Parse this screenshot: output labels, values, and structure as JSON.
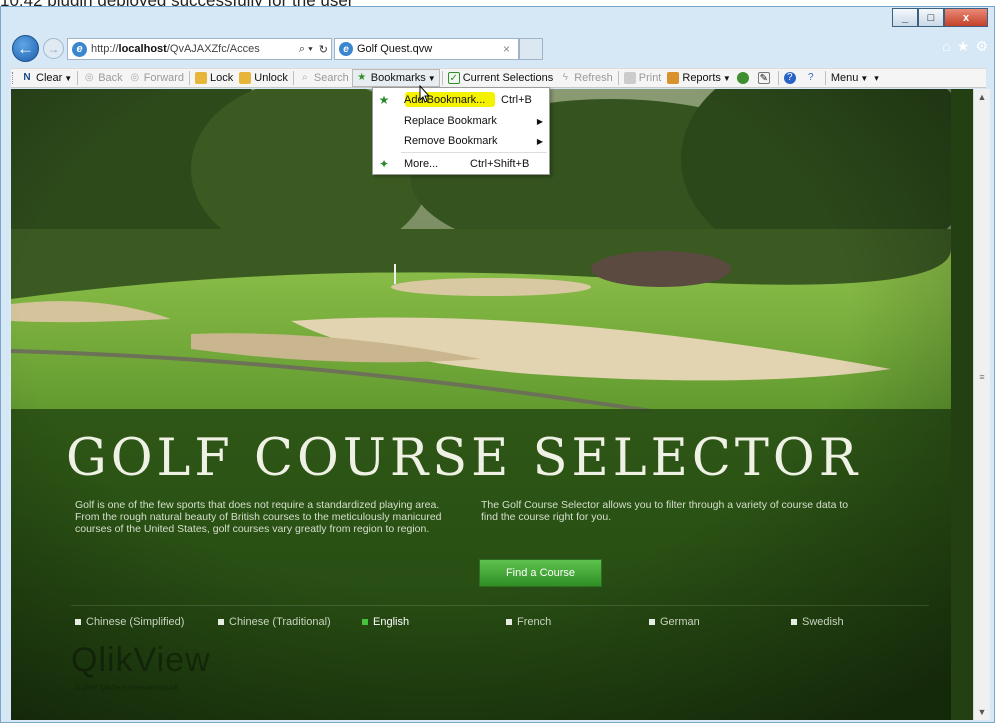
{
  "caption": "10.42 plugin deployed successfully for the user",
  "window": {
    "controls": [
      "_",
      "□",
      "x"
    ],
    "right_icons": [
      "⌂",
      "★",
      "⚙"
    ]
  },
  "browser": {
    "back_icon": "back-arrow-icon",
    "forward_icon": "forward-arrow-icon",
    "url_prefix": "http://",
    "url_host": "localhost",
    "url_path": "/QvAJAXZfc/Acces",
    "search_icon": "⌕",
    "refresh_icon": "↻",
    "tab_title": "Golf Quest.qvw",
    "tab_close": "×"
  },
  "toolbar": {
    "clear": "Clear",
    "back": "Back",
    "forward": "Forward",
    "lock": "Lock",
    "unlock": "Unlock",
    "search": "Search",
    "bookmarks": "Bookmarks",
    "current_selections": "Current Selections",
    "refresh": "Refresh",
    "print": "Print",
    "reports": "Reports",
    "menu": "Menu"
  },
  "bookmarks_menu": {
    "items": [
      {
        "label": "Add Bookmark...",
        "shortcut": "Ctrl+B",
        "icon": "star-icon"
      },
      {
        "label": "Replace Bookmark",
        "shortcut": "",
        "submenu": true
      },
      {
        "label": "Remove Bookmark",
        "shortcut": "",
        "submenu": true
      },
      {
        "label": "More...",
        "shortcut": "Ctrl+Shift+B",
        "icon": "stars-icon"
      }
    ]
  },
  "page": {
    "title": "GOLF COURSE SELECTOR",
    "intro_left": "Golf is one of the few sports that does not require a standardized playing area. From the rough natural beauty of British courses to the meticulously manicured courses of the United States, golf courses vary greatly from region to region.",
    "intro_right": "The Golf Course Selector allows you to filter through a variety of course data to find the course right for you.",
    "button": "Find a Course",
    "languages": [
      "Chinese (Simplified)",
      "Chinese (Traditional)",
      "English",
      "French",
      "German",
      "Swedish"
    ],
    "active_language": "English",
    "logo": "QlikView",
    "logo_sub": "© 2009 QlikTech International AB"
  },
  "colors": {
    "accent_green": "#47c33a",
    "highlight": "#f5f200",
    "ie_blue": "#1c5fae"
  }
}
